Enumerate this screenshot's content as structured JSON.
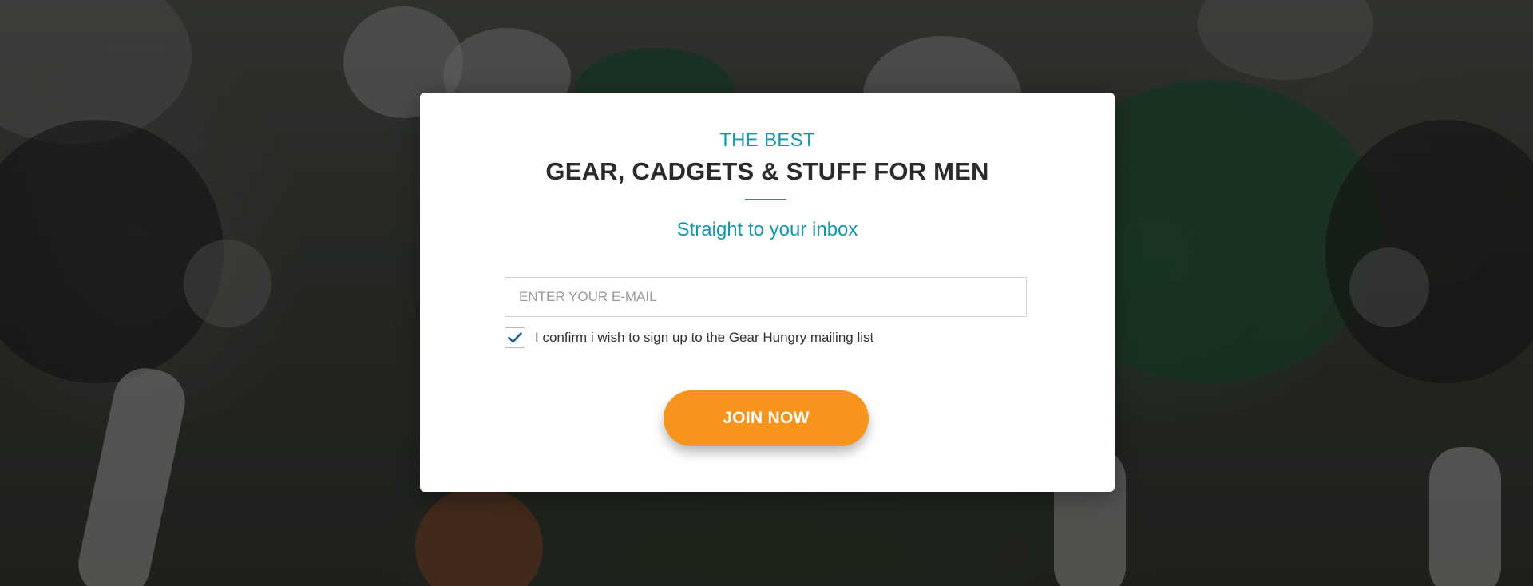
{
  "background": {
    "description_icon": "football-players-photo"
  },
  "modal": {
    "eyebrow": "THE BEST",
    "headline": "GEAR, CADGETS & STUFF FOR MEN",
    "subhead": "Straight to your inbox",
    "email_input": {
      "placeholder": "ENTER YOUR E-MAIL",
      "value": ""
    },
    "consent": {
      "checked": true,
      "label": "I confirm i wish to sign up to the Gear Hungry mailing list",
      "icon": "checkmark-icon"
    },
    "cta_label": "JOIN NOW"
  },
  "colors": {
    "accent_teal": "#1796ab",
    "cta_orange": "#f7941d",
    "headline_dark": "#2b2b2b",
    "checkmark_blue": "#1a5f8a"
  }
}
